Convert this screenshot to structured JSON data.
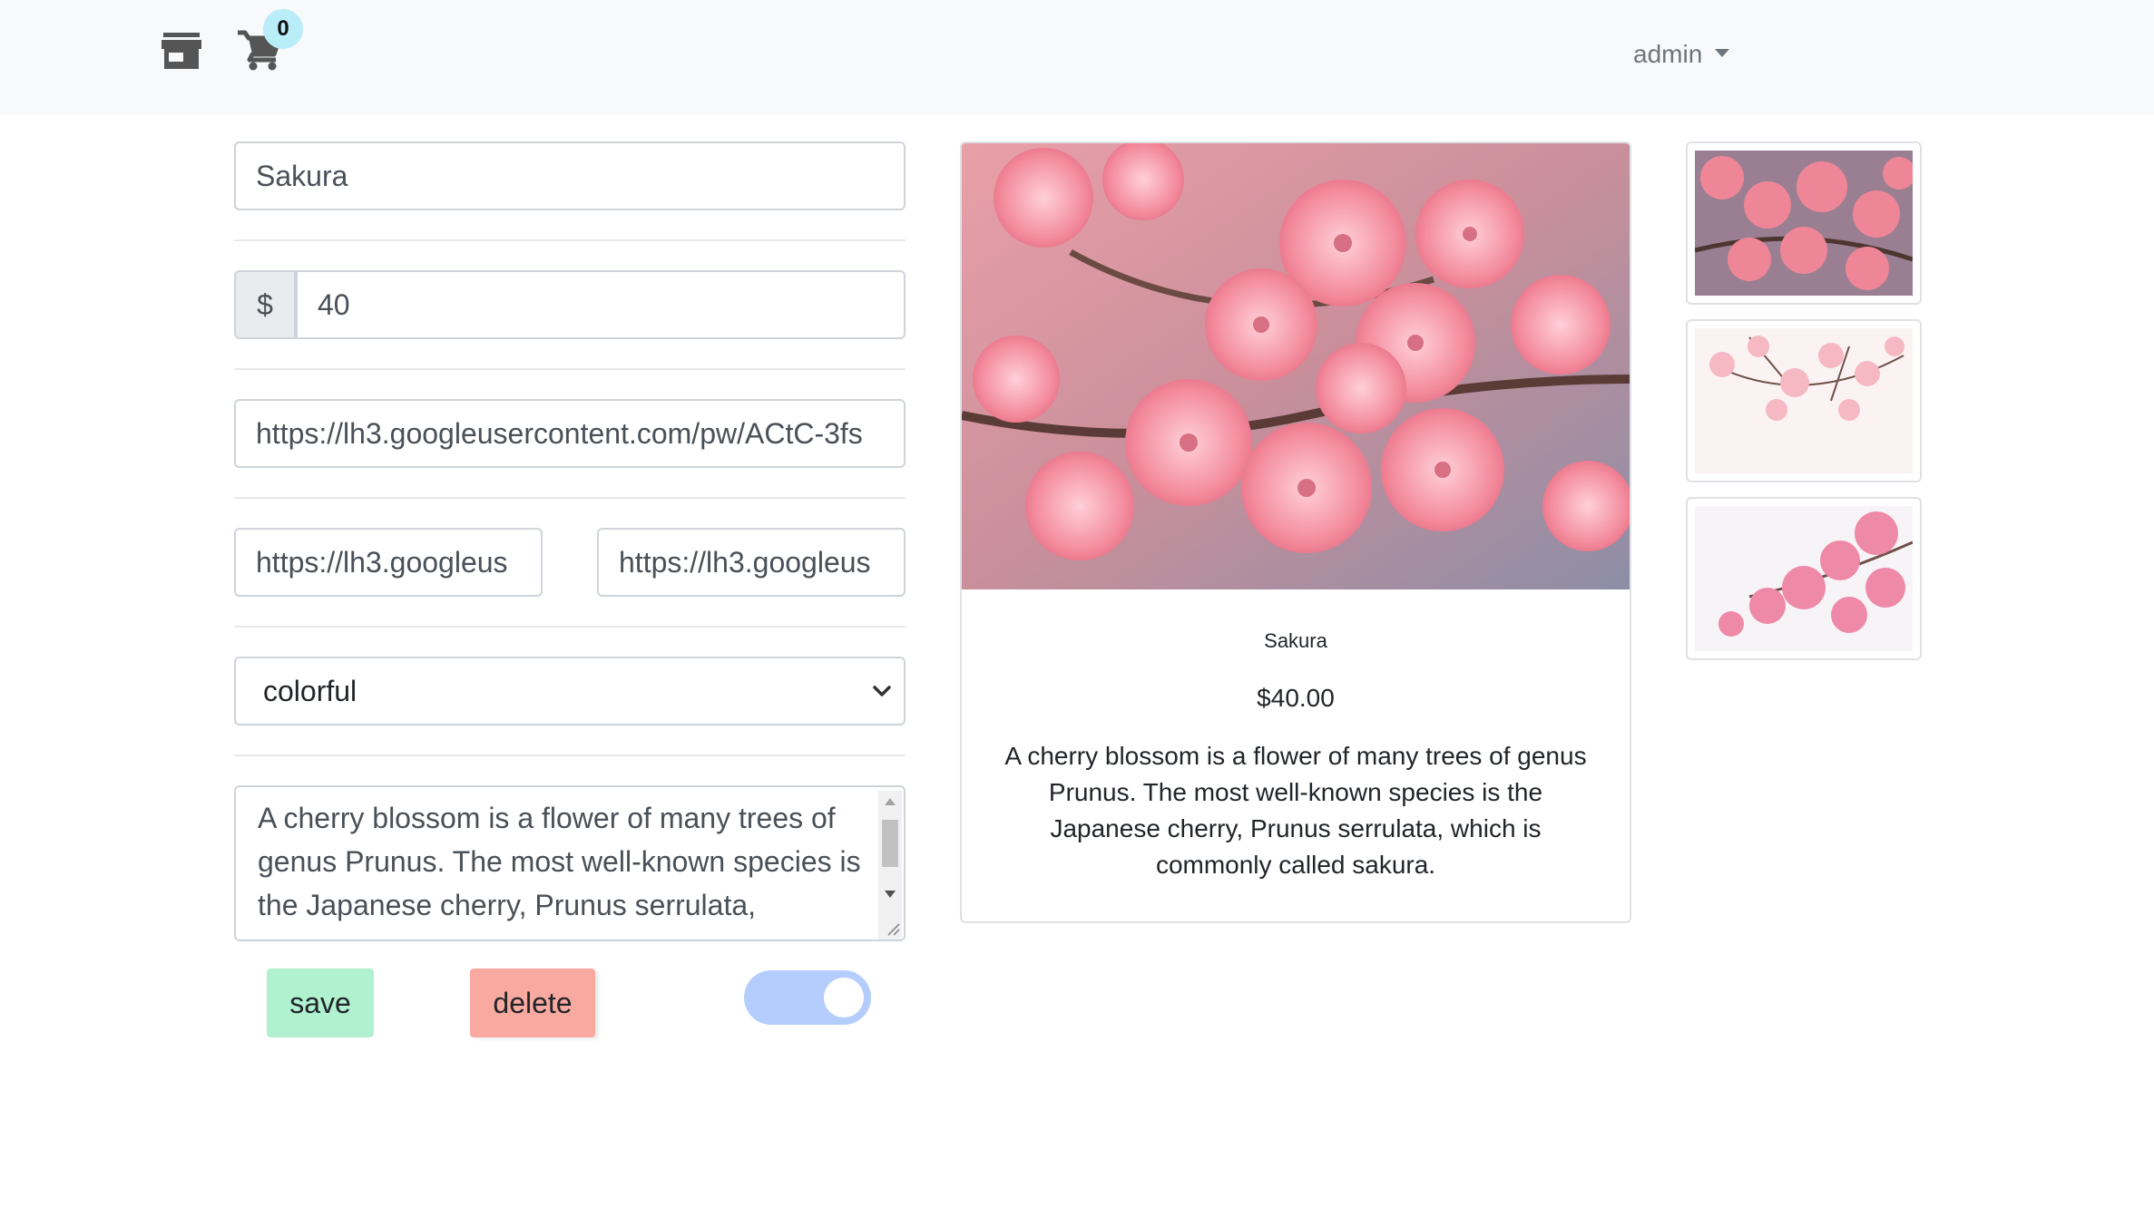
{
  "navbar": {
    "store_icon": "store-icon",
    "cart_icon": "shopping-cart-icon",
    "cart_count": "0",
    "user_label": "admin"
  },
  "form": {
    "name_value": "Sakura",
    "price_prefix": "$",
    "price_value": "40",
    "image_url_value": "https://lh3.googleusercontent.com/pw/ACtC-3fs",
    "image_url_2_value": "https://lh3.googleus",
    "image_url_3_value": "https://lh3.googleus",
    "category_selected": "colorful",
    "description_value": "A cherry blossom is a flower of many trees of genus Prunus. The most well-known species is the Japanese cherry, Prunus serrulata,",
    "save_label": "save",
    "delete_label": "delete",
    "toggle_state": "on"
  },
  "card": {
    "title": "Sakura",
    "price": "$40.00",
    "description": "A cherry blossom is a flower of many trees of genus Prunus. The most well-known species is the Japanese cherry, Prunus serrulata, which is commonly called sakura."
  },
  "colors": {
    "navbar_bg": "#f8f9fa",
    "badge_bg": "#b9eef9",
    "save_bg": "#b0f2d0",
    "delete_bg": "#f8a9a0",
    "toggle_bg": "#b4cdfd",
    "blossom_pink": "#f07f92"
  }
}
